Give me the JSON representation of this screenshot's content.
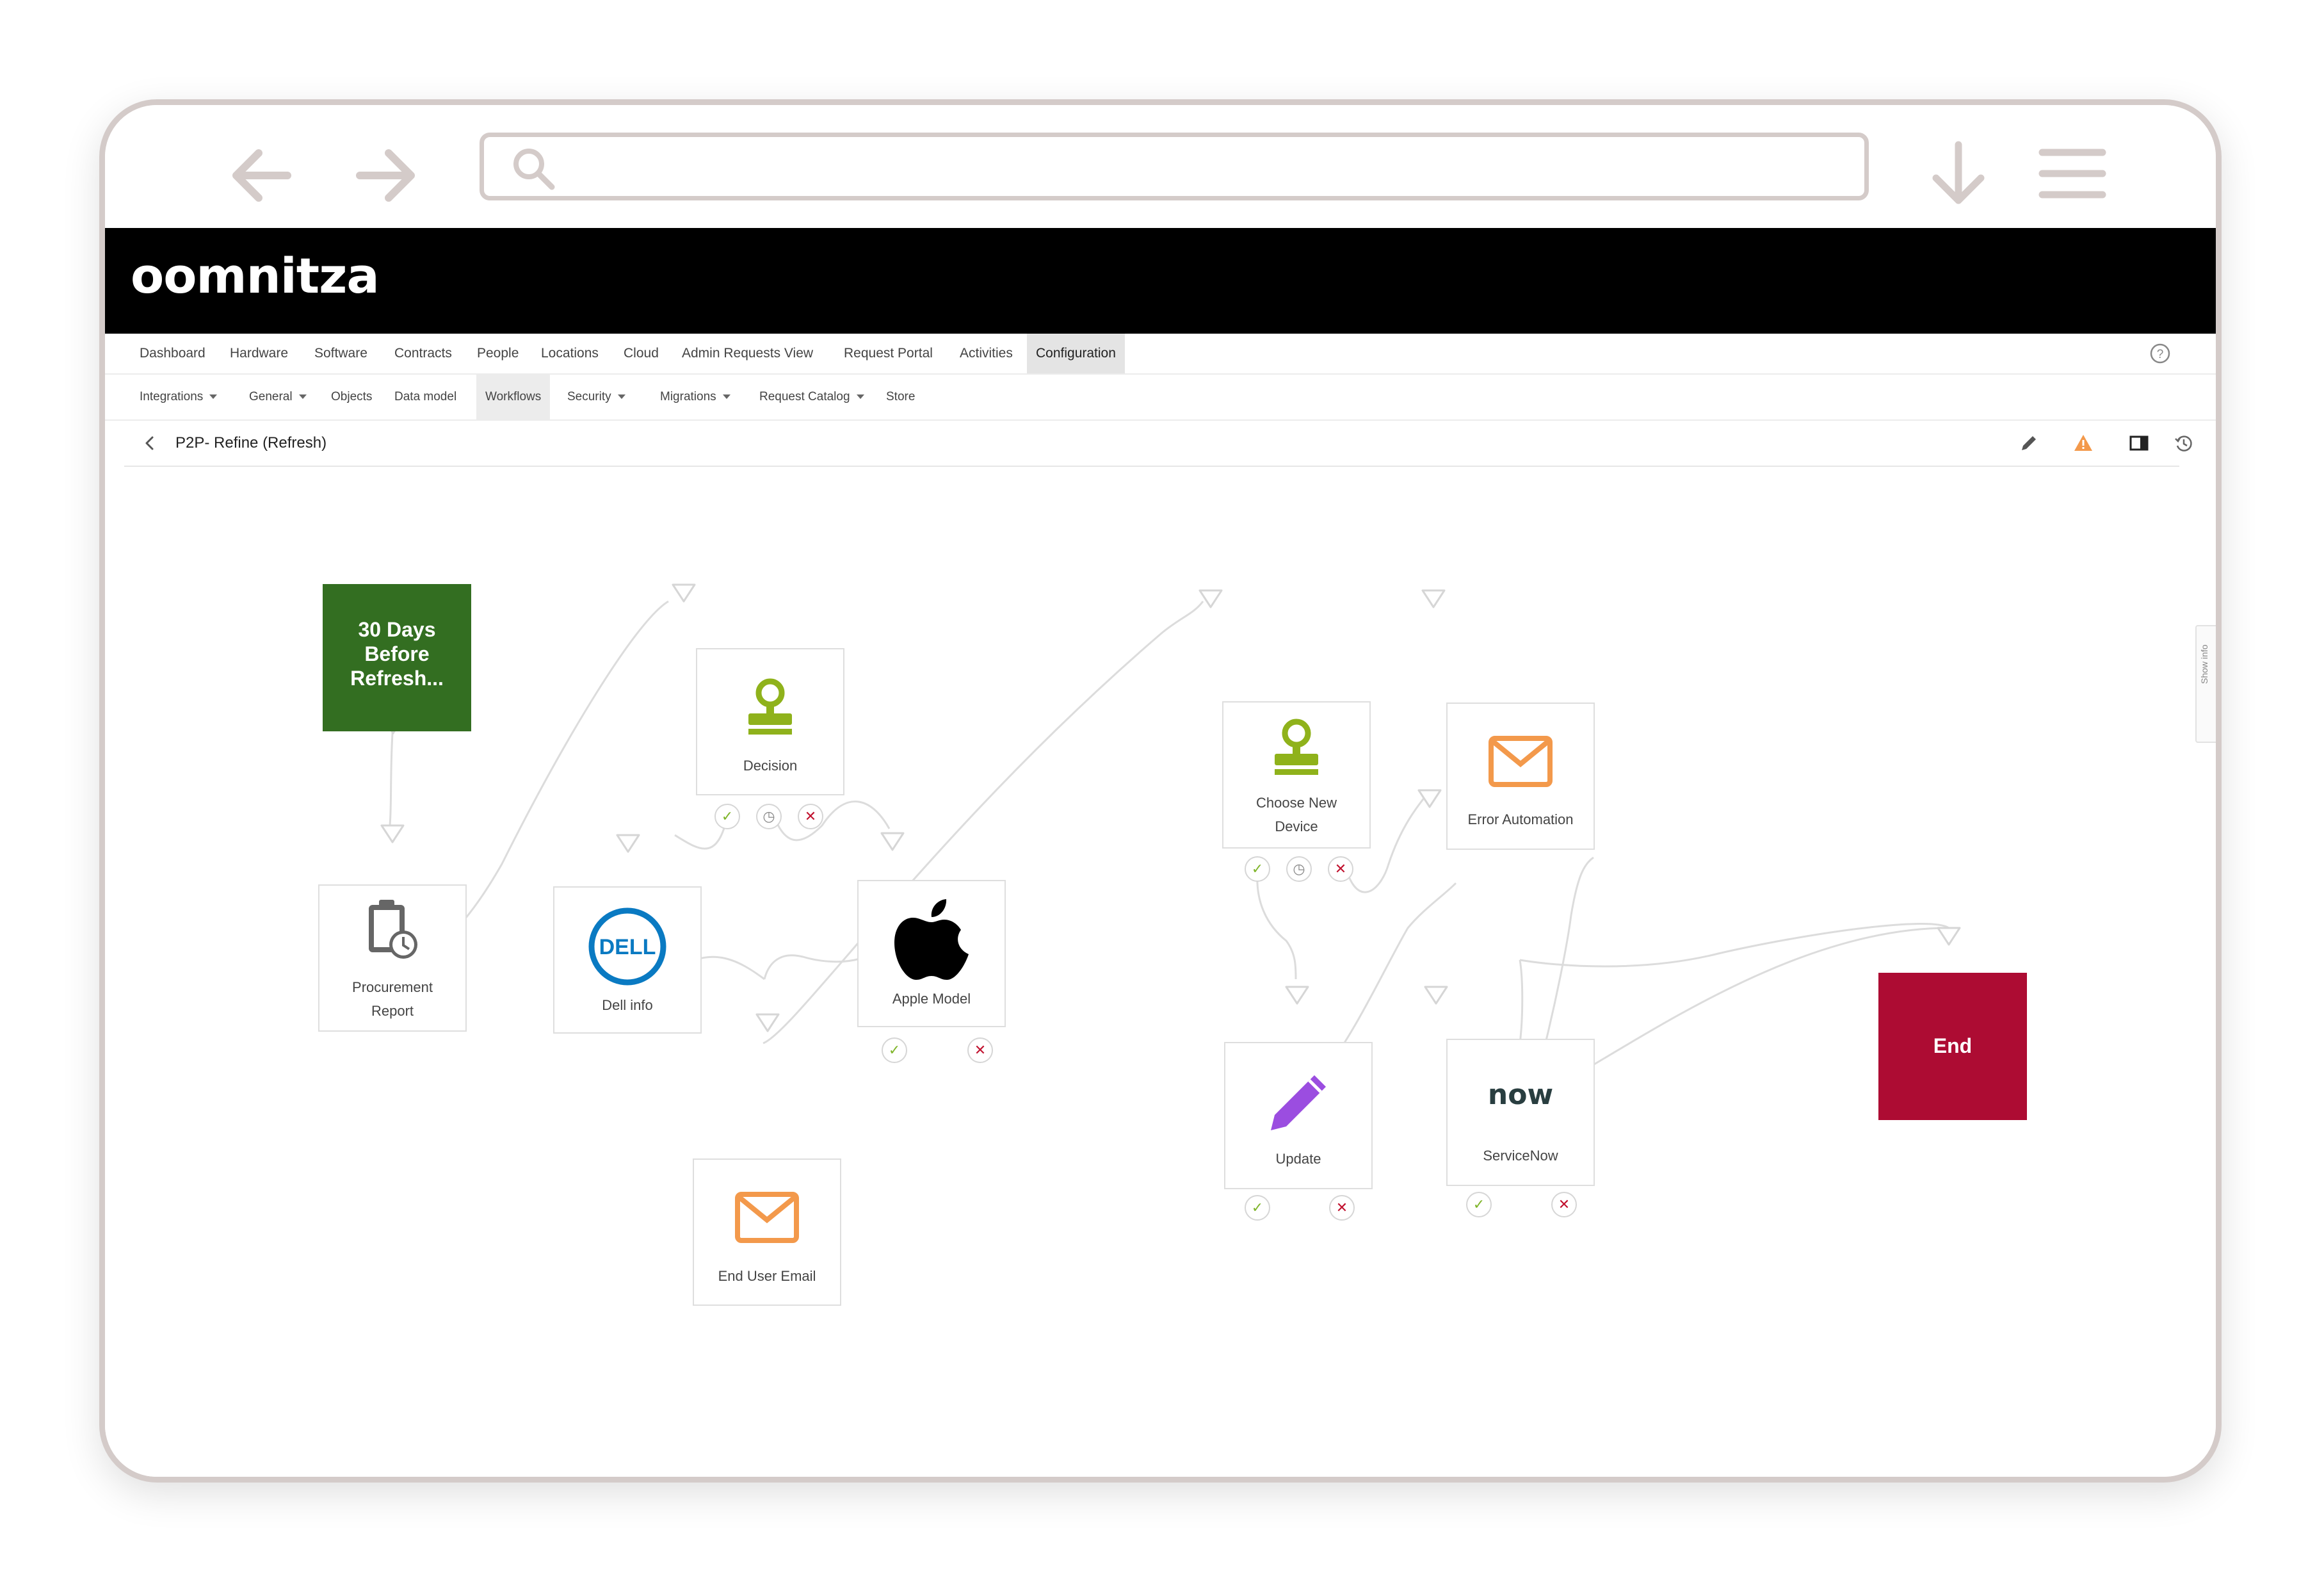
{
  "app": {
    "logo": "oomnitza",
    "workflow_title": "P2P- Refine (Refresh)",
    "side_tab": "Show info"
  },
  "menu_primary": [
    {
      "label": "Dashboard"
    },
    {
      "label": "Hardware"
    },
    {
      "label": "Software"
    },
    {
      "label": "Contracts"
    },
    {
      "label": "People"
    },
    {
      "label": "Locations"
    },
    {
      "label": "Cloud"
    },
    {
      "label": "Admin Requests View"
    },
    {
      "label": "Request Portal"
    },
    {
      "label": "Activities"
    },
    {
      "label": "Configuration",
      "active": true
    }
  ],
  "menu_secondary": [
    {
      "label": "Integrations",
      "dropdown": true
    },
    {
      "label": "General",
      "dropdown": true
    },
    {
      "label": "Objects"
    },
    {
      "label": "Data model"
    },
    {
      "label": "Workflows",
      "active": true
    },
    {
      "label": "Security",
      "dropdown": true
    },
    {
      "label": "Migrations",
      "dropdown": true
    },
    {
      "label": "Request Catalog",
      "dropdown": true
    },
    {
      "label": "Store"
    }
  ],
  "header_icons": [
    "pencil-icon",
    "warning-icon",
    "panel-icon",
    "history-icon"
  ],
  "nodes": {
    "start": "30 Days Before Refresh...",
    "procurement": "Procurement Report",
    "decision": "Decision",
    "dell": "Dell info",
    "dell_logo": "DELL",
    "apple": "Apple Model",
    "email": "End User Email",
    "choose": "Choose New Device",
    "error": "Error Automation",
    "update": "Update",
    "servicenow": "ServiceNow",
    "servicenow_logo": "now",
    "end": "End"
  },
  "colors": {
    "start": "#336e21",
    "end": "#ad0c33",
    "approval": "#8fb21b",
    "email": "#f3994b",
    "update": "#9b4de0",
    "dell": "#0a7ac2",
    "ok": "#7fb52a",
    "cancel": "#c1122f"
  }
}
